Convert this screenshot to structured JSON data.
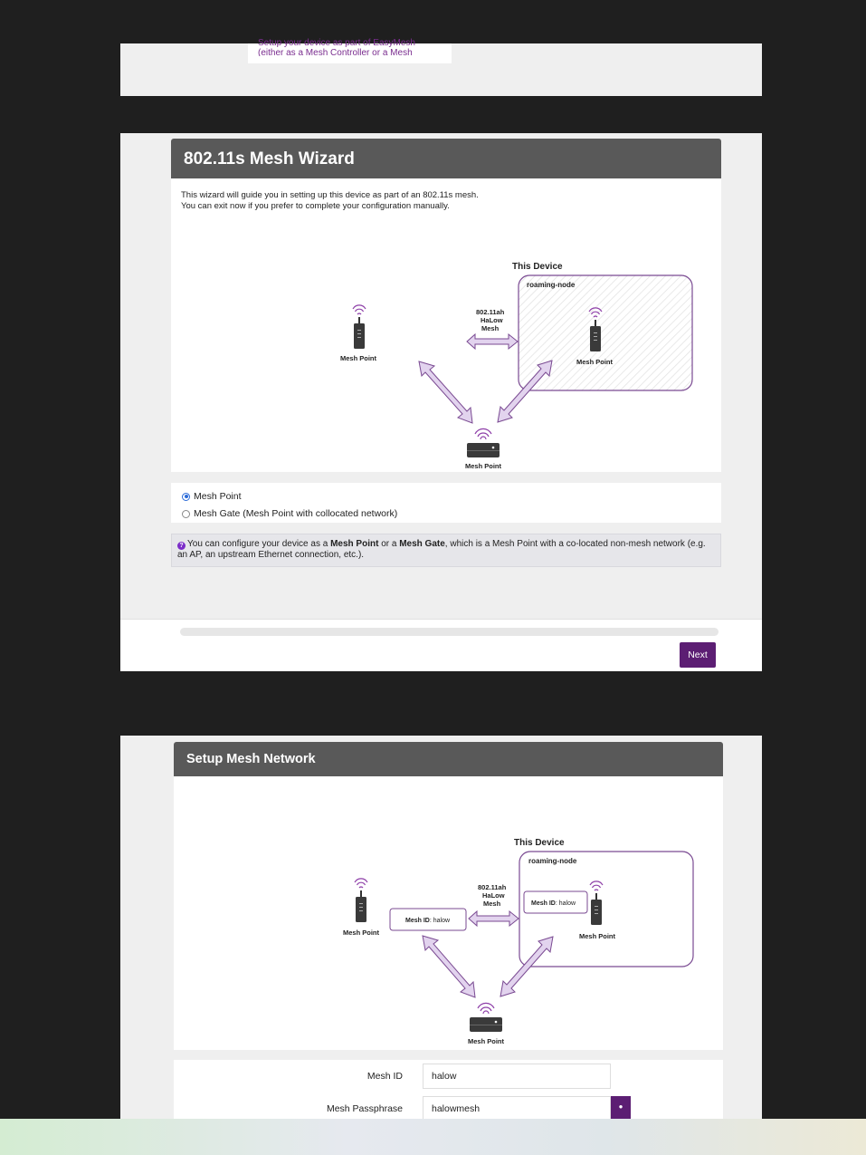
{
  "top_fragment": {
    "text": "Setup your device as part of EasyMesh (either as a Mesh Controller or a Mesh Agent)."
  },
  "wizard": {
    "title": "802.11s Mesh Wizard",
    "intro_line1": "This wizard will guide you in setting up this device as part of an 802.11s mesh.",
    "intro_line2": "You can exit now if you prefer to complete your configuration manually.",
    "diagram": {
      "this_device": "This Device",
      "node_name": "roaming-node",
      "link_label_1": "802.11ah",
      "link_label_2": "HaLow",
      "link_label_3": "Mesh",
      "mesh_point_left": "Mesh Point",
      "mesh_point_right": "Mesh Point",
      "mesh_point_bottom": "Mesh Point"
    },
    "options": [
      {
        "label": "Mesh Point",
        "selected": true
      },
      {
        "label": "Mesh Gate (Mesh Point with collocated network)",
        "selected": false
      }
    ],
    "info": {
      "part1": "You can configure your device as a ",
      "bold1": "Mesh Point",
      "part2": " or a ",
      "bold2": "Mesh Gate",
      "part3": ", which is a Mesh Point with a co-located non-mesh network (e.g. an AP, an upstream Ethernet connection, etc.)."
    },
    "next_label": "Next"
  },
  "setup": {
    "title": "Setup Mesh Network",
    "diagram": {
      "this_device": "This Device",
      "node_name": "roaming-node",
      "link_label_1": "802.11ah",
      "link_label_2": "HaLow",
      "link_label_3": "Mesh",
      "mesh_id_prefix": "Mesh ID",
      "mesh_id_value": ": halow",
      "mesh_point_left": "Mesh Point",
      "mesh_point_right": "Mesh Point",
      "mesh_point_bottom": "Mesh Point"
    },
    "fields": {
      "mesh_id_label": "Mesh ID",
      "mesh_id_value": "halow",
      "passphrase_label": "Mesh Passphrase",
      "passphrase_value": "halowmesh"
    }
  },
  "colors": {
    "accent": "#5c1e73",
    "wifi": "#8e3fa8",
    "arrow_fill": "#e2d3ee",
    "arrow_stroke": "#7a4a92",
    "titlebar": "#595959",
    "panel": "#efefef"
  }
}
